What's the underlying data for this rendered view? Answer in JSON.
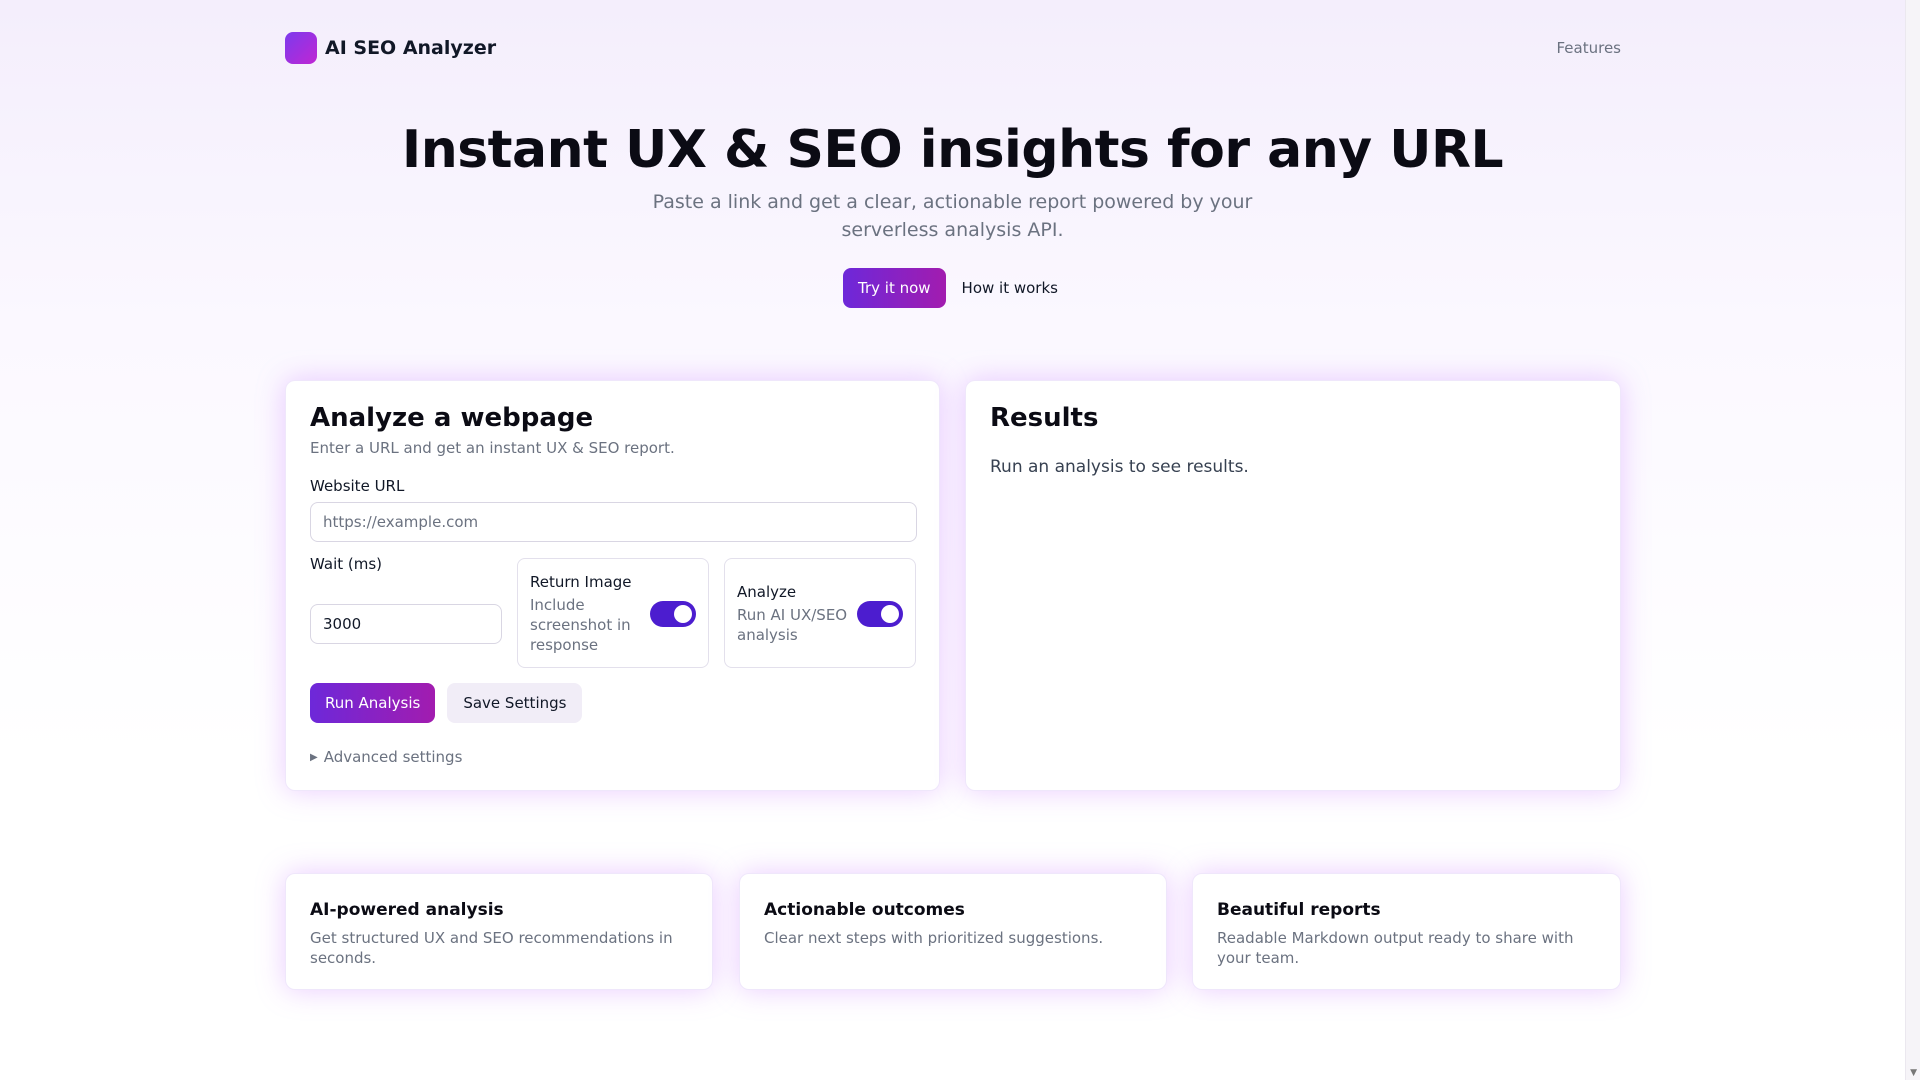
{
  "header": {
    "brand": "AI SEO Analyzer",
    "nav_features": "Features"
  },
  "hero": {
    "title": "Instant UX & SEO insights for any URL",
    "subtitle": "Paste a link and get a clear, actionable report powered by your serverless analysis API.",
    "try_label": "Try it now",
    "how_label": "How it works"
  },
  "analyze": {
    "title": "Analyze a webpage",
    "subtitle": "Enter a URL and get an instant UX & SEO report.",
    "url_label": "Website URL",
    "url_placeholder": "https://example.com",
    "url_value": "",
    "wait_label": "Wait (ms)",
    "wait_value": "3000",
    "return_image": {
      "title": "Return Image",
      "desc": "Include screenshot in response",
      "enabled": true
    },
    "analyze_opt": {
      "title": "Analyze",
      "desc": "Run AI UX/SEO analysis",
      "enabled": true
    },
    "run_label": "Run Analysis",
    "save_label": "Save Settings",
    "advanced_label": "Advanced settings"
  },
  "results": {
    "title": "Results",
    "empty_text": "Run an analysis to see results."
  },
  "features": [
    {
      "title": "AI-powered analysis",
      "desc": "Get structured UX and SEO recommendations in seconds."
    },
    {
      "title": "Actionable outcomes",
      "desc": "Clear next steps with prioritized suggestions."
    },
    {
      "title": "Beautiful reports",
      "desc": "Readable Markdown output ready to share with your team."
    }
  ],
  "colors": {
    "accent": "#6d28d9",
    "accent_end": "#a21caf",
    "toggle_on": "#4c1dcf"
  }
}
